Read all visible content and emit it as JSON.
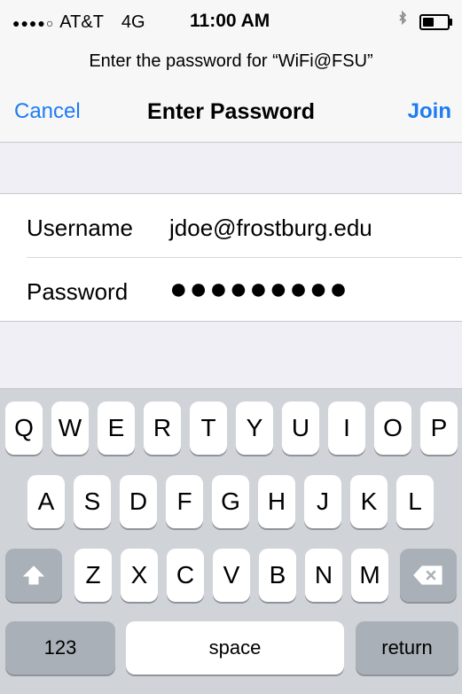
{
  "status_bar": {
    "signal": "●●●●○",
    "carrier": "AT&T",
    "network": "4G",
    "time": "11:00 AM",
    "bluetooth_icon": "bluetooth-icon",
    "battery_icon": "battery-icon"
  },
  "prompt": "Enter the password for “WiFi@FSU”",
  "nav": {
    "cancel": "Cancel",
    "title": "Enter Password",
    "join": "Join",
    "accent_color": "#1e7cf2"
  },
  "form": {
    "username_label": "Username",
    "username_value": "jdoe@frostburg.edu",
    "password_label": "Password",
    "password_value": "●●●●●●●●●"
  },
  "keyboard": {
    "row1": [
      "Q",
      "W",
      "E",
      "R",
      "T",
      "Y",
      "U",
      "I",
      "O",
      "P"
    ],
    "row2": [
      "A",
      "S",
      "D",
      "F",
      "G",
      "H",
      "J",
      "K",
      "L"
    ],
    "row3": [
      "Z",
      "X",
      "C",
      "V",
      "B",
      "N",
      "M"
    ],
    "numbers": "123",
    "space": "space",
    "return": "return",
    "shift_icon": "shift-icon",
    "delete_icon": "delete-icon"
  }
}
